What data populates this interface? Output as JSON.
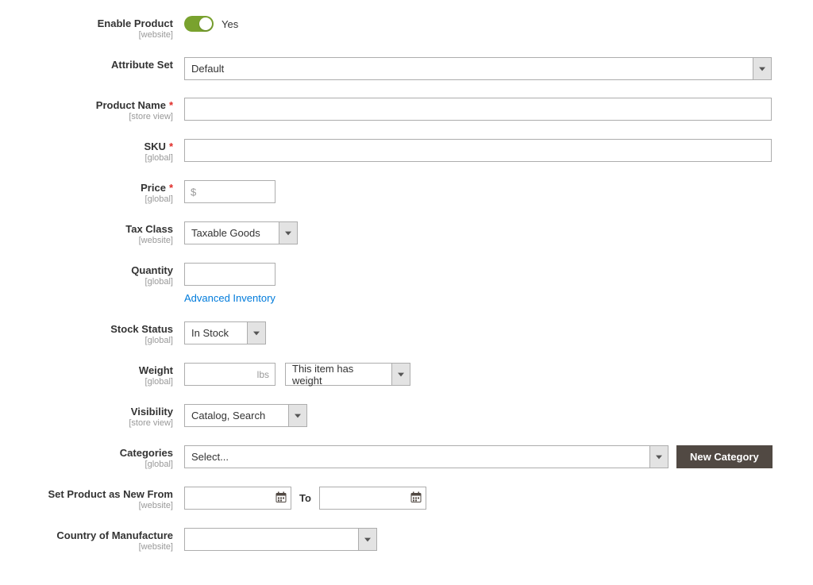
{
  "fields": {
    "enable_product": {
      "label": "Enable Product",
      "scope": "[website]",
      "value_label": "Yes"
    },
    "attribute_set": {
      "label": "Attribute Set",
      "value": "Default"
    },
    "product_name": {
      "label": "Product Name",
      "scope": "[store view]",
      "value": ""
    },
    "sku": {
      "label": "SKU",
      "scope": "[global]",
      "value": ""
    },
    "price": {
      "label": "Price",
      "scope": "[global]",
      "currency": "$",
      "value": ""
    },
    "tax_class": {
      "label": "Tax Class",
      "scope": "[website]",
      "value": "Taxable Goods"
    },
    "quantity": {
      "label": "Quantity",
      "scope": "[global]",
      "value": "",
      "advanced_link": "Advanced Inventory"
    },
    "stock_status": {
      "label": "Stock Status",
      "scope": "[global]",
      "value": "In Stock"
    },
    "weight": {
      "label": "Weight",
      "scope": "[global]",
      "value": "",
      "unit": "lbs",
      "option": "This item has weight"
    },
    "visibility": {
      "label": "Visibility",
      "scope": "[store view]",
      "value": "Catalog, Search"
    },
    "categories": {
      "label": "Categories",
      "scope": "[global]",
      "value": "Select...",
      "new_btn": "New Category"
    },
    "new_from": {
      "label": "Set Product as New From",
      "scope": "[website]",
      "to_label": "To",
      "from": "",
      "to": ""
    },
    "country": {
      "label": "Country of Manufacture",
      "scope": "[website]",
      "value": ""
    }
  }
}
